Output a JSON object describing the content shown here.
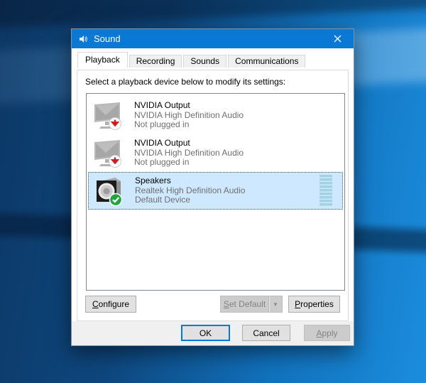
{
  "window": {
    "title": "Sound",
    "close_glyph": "✕"
  },
  "tabs": [
    {
      "label": "Playback",
      "active": true
    },
    {
      "label": "Recording",
      "active": false
    },
    {
      "label": "Sounds",
      "active": false
    },
    {
      "label": "Communications",
      "active": false
    }
  ],
  "instruction": "Select a playback device below to modify its settings:",
  "devices": [
    {
      "name": "NVIDIA Output",
      "description": "NVIDIA High Definition Audio",
      "status": "Not plugged in",
      "icon": "monitor-icon",
      "badge": "red-down-arrow",
      "selected": false
    },
    {
      "name": "NVIDIA Output",
      "description": "NVIDIA High Definition Audio",
      "status": "Not plugged in",
      "icon": "monitor-icon",
      "badge": "red-down-arrow",
      "selected": false
    },
    {
      "name": "Speakers",
      "description": "Realtek High Definition Audio",
      "status": "Default Device",
      "icon": "speaker-icon",
      "badge": "green-check",
      "selected": true
    }
  ],
  "buttons": {
    "configure": {
      "accel": "C",
      "rest": "onfigure"
    },
    "set_default": {
      "accel": "S",
      "rest": "et Default",
      "arrow": "▼",
      "disabled": true
    },
    "properties": {
      "accel": "P",
      "rest": "roperties"
    },
    "ok": {
      "label": "OK",
      "focused": true
    },
    "cancel": {
      "label": "Cancel"
    },
    "apply": {
      "accel": "A",
      "rest": "pply",
      "disabled": true
    }
  },
  "colors": {
    "titlebar": "#0a79d6",
    "selection_bg": "#cde8ff",
    "meter_segment": "#a3d3e2",
    "focus_border": "#0078d7",
    "disabled_text": "#838383",
    "secondary_text": "#707070"
  }
}
